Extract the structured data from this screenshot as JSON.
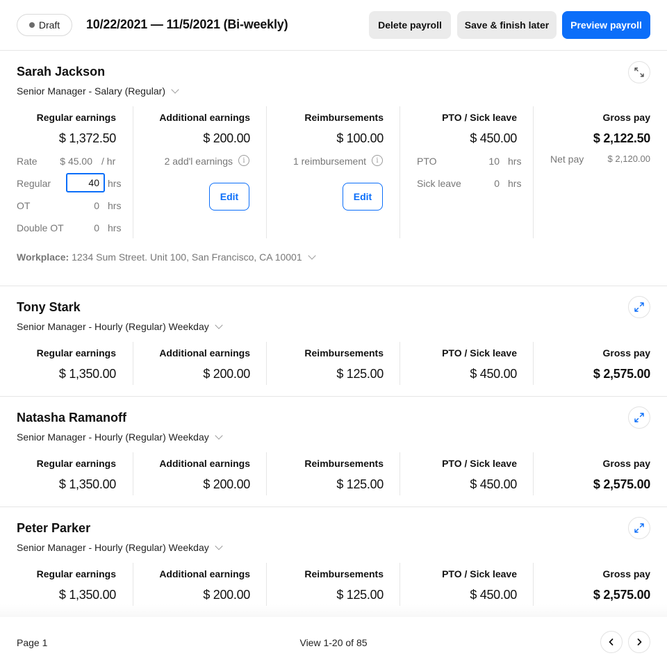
{
  "header": {
    "status": "Draft",
    "period": "10/22/2021 — 11/5/2021  (Bi-weekly)",
    "delete_label": "Delete payroll",
    "save_label": "Save & finish later",
    "preview_label": "Preview payroll"
  },
  "columns": {
    "regular": "Regular earnings",
    "additional": "Additional earnings",
    "reimbursements": "Reimbursements",
    "pto": "PTO / Sick leave",
    "gross": "Gross pay"
  },
  "employees": [
    {
      "name": "Sarah Jackson",
      "role": "Senior Manager - Salary (Regular)",
      "regular": "$ 1,372.50",
      "additional": "$ 200.00",
      "reimbursements": "$ 100.00",
      "pto": "$ 450.00",
      "gross": "$ 2,122.50",
      "expanded": true,
      "details": {
        "rate_label": "Rate",
        "rate_value": "$ 45.00",
        "rate_unit": "/ hr",
        "regular_label": "Regular",
        "regular_hours": "40",
        "ot_label": "OT",
        "ot_hours": "0",
        "double_ot_label": "Double OT",
        "double_ot_hours": "0",
        "hrs_unit": "hrs",
        "addl_count": "2 add'l earnings",
        "reimb_count": "1 reimbursement",
        "edit_label": "Edit",
        "pto_label": "PTO",
        "pto_hours": "10",
        "sick_label": "Sick leave",
        "sick_hours": "0",
        "net_label": "Net pay",
        "net_value": "$ 2,120.00",
        "workplace_label": "Workplace:",
        "workplace_value": "1234 Sum Street. Unit 100, San Francisco, CA 10001"
      }
    },
    {
      "name": "Tony Stark",
      "role": "Senior Manager - Hourly (Regular) Weekday",
      "regular": "$ 1,350.00",
      "additional": "$ 200.00",
      "reimbursements": "$ 125.00",
      "pto": "$ 450.00",
      "gross": "$ 2,575.00",
      "expanded": false
    },
    {
      "name": "Natasha Ramanoff",
      "role": "Senior Manager - Hourly (Regular) Weekday",
      "regular": "$ 1,350.00",
      "additional": "$ 200.00",
      "reimbursements": "$ 125.00",
      "pto": "$ 450.00",
      "gross": "$ 2,575.00",
      "expanded": false
    },
    {
      "name": "Peter Parker",
      "role": "Senior Manager - Hourly (Regular) Weekday",
      "regular": "$ 1,350.00",
      "additional": "$ 200.00",
      "reimbursements": "$ 125.00",
      "pto": "$ 450.00",
      "gross": "$ 2,575.00",
      "expanded": false
    }
  ],
  "footer": {
    "page": "Page 1",
    "view": "View 1-20 of 85"
  },
  "icons": {
    "collapse": "collapse-arrows-icon",
    "expand": "expand-arrows-icon",
    "prev": "chevron-left-icon",
    "next": "chevron-right-icon",
    "info": "info-icon",
    "dropdown": "chevron-down-icon"
  },
  "colors": {
    "accent": "#0b6ef9",
    "muted_text": "#777777",
    "divider": "#e6e6e6"
  }
}
